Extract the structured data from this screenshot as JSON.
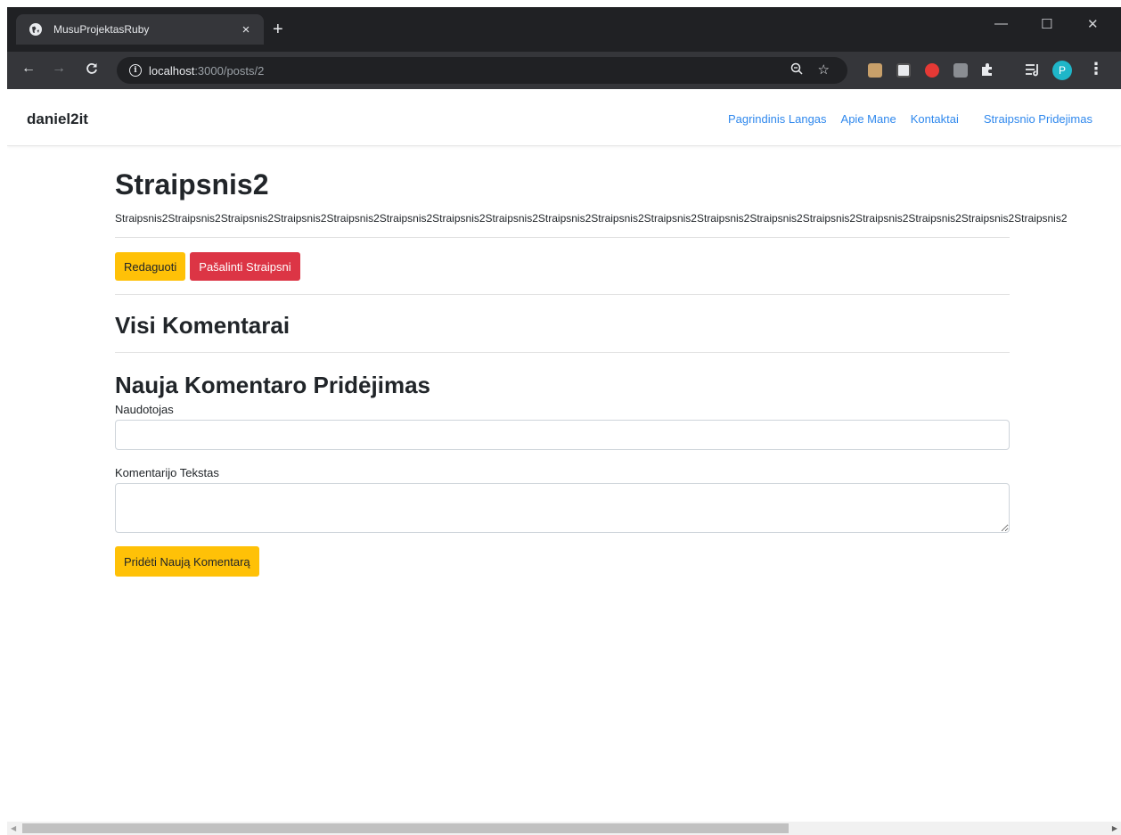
{
  "browser": {
    "tab_title": "MusuProjektasRuby",
    "tab_close": "×",
    "new_tab": "+",
    "url_host": "localhost",
    "url_path": ":3000/posts/2",
    "profile_initial": "P",
    "window_controls": {
      "minimize": "—",
      "maximize": "☐",
      "close": "✕"
    }
  },
  "navbar": {
    "brand": "daniel2it",
    "links": [
      "Pagrindinis Langas",
      "Apie Mane",
      "Kontaktai",
      "Straipsnio Pridejimas"
    ]
  },
  "post": {
    "title": "Straipsnis2",
    "body": "Straipsnis2Straipsnis2Straipsnis2Straipsnis2Straipsnis2Straipsnis2Straipsnis2Straipsnis2Straipsnis2Straipsnis2Straipsnis2Straipsnis2Straipsnis2Straipsnis2Straipsnis2Straipsnis2Straipsnis2Straipsnis2",
    "edit_label": "Redaguoti",
    "delete_label": "Pašalinti Straipsni"
  },
  "comments": {
    "heading": "Visi Komentarai"
  },
  "new_comment": {
    "heading": "Nauja Komentaro Pridėjimas",
    "user_label": "Naudotojas",
    "user_value": "",
    "text_label": "Komentarijo Tekstas",
    "text_value": "",
    "submit_label": "Pridėti Naują Komentarą"
  },
  "colors": {
    "warning": "#ffc107",
    "danger": "#dc3545",
    "link": "#2f88ed",
    "chrome_dark": "#202124"
  }
}
